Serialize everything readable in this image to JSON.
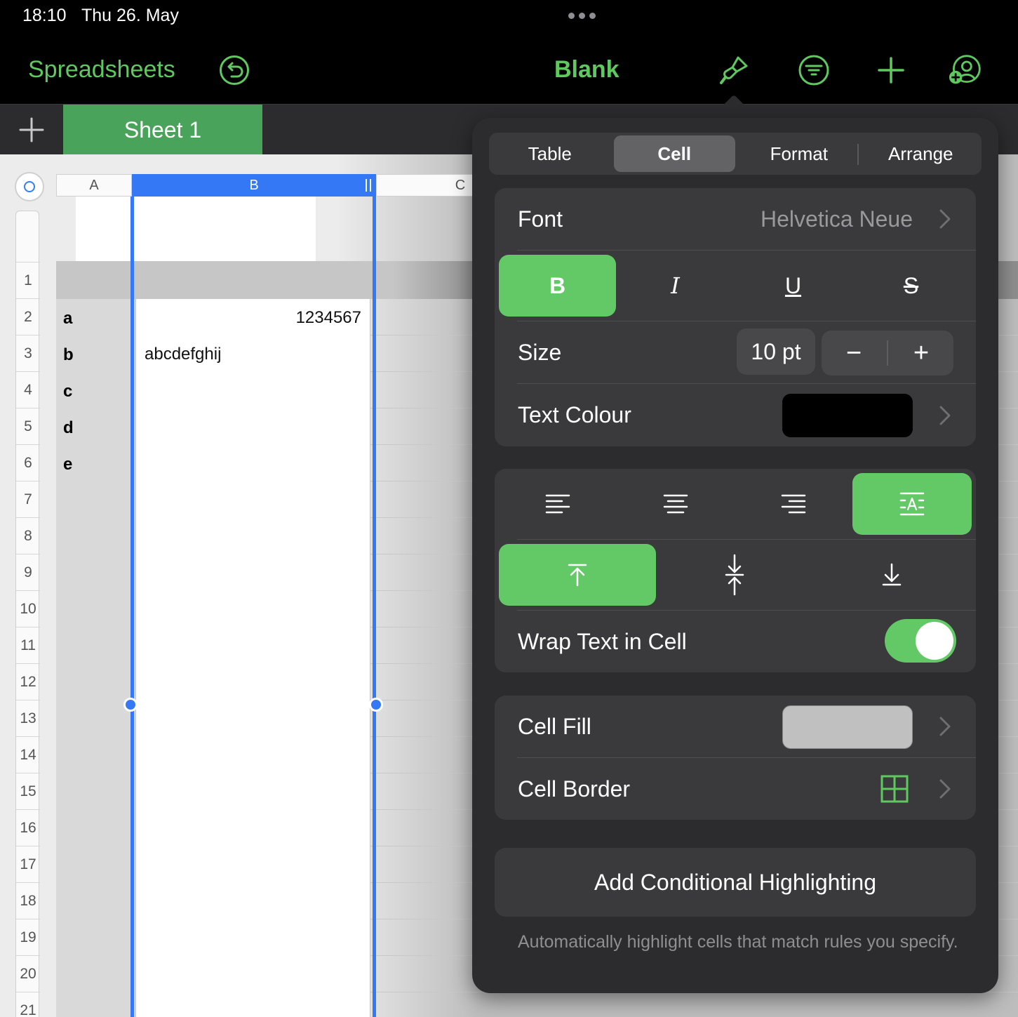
{
  "status": {
    "time": "18:10",
    "date": "Thu 26. May"
  },
  "toolbar": {
    "back_label": "Spreadsheets",
    "title": "Blank"
  },
  "tabs": {
    "sheet_label": "Sheet 1"
  },
  "columns": [
    "A",
    "B",
    "C"
  ],
  "rows": [
    "1",
    "2",
    "3",
    "4",
    "5",
    "6",
    "7",
    "8",
    "9",
    "10",
    "11",
    "12",
    "13",
    "14",
    "15",
    "16",
    "17",
    "18",
    "19",
    "20",
    "21"
  ],
  "table": {
    "cells": [
      {
        "a": "a",
        "b": "1234567"
      },
      {
        "a": "b",
        "b": "abcdefghij"
      },
      {
        "a": "c",
        "b": ""
      },
      {
        "a": "d",
        "b": ""
      },
      {
        "a": "e",
        "b": ""
      }
    ]
  },
  "popover": {
    "segments": [
      "Table",
      "Cell",
      "Format",
      "Arrange"
    ],
    "active_segment": "Cell",
    "font_label": "Font",
    "font_value": "Helvetica Neue",
    "bold": "B",
    "italic": "I",
    "underline": "U",
    "strike": "S",
    "size_label": "Size",
    "size_value": "10 pt",
    "minus": "−",
    "plus": "+",
    "text_colour_label": "Text Colour",
    "wrap_label": "Wrap Text in Cell",
    "cell_fill_label": "Cell Fill",
    "cell_border_label": "Cell Border",
    "cond_button": "Add Conditional Highlighting",
    "cond_note": "Automatically highlight cells that match rules you specify."
  },
  "colors": {
    "accent": "#5fc95f",
    "selected": "#62c966",
    "selection_blue": "#3478f6",
    "text_colour": "#000000",
    "cell_fill": "#c0c0c0"
  }
}
